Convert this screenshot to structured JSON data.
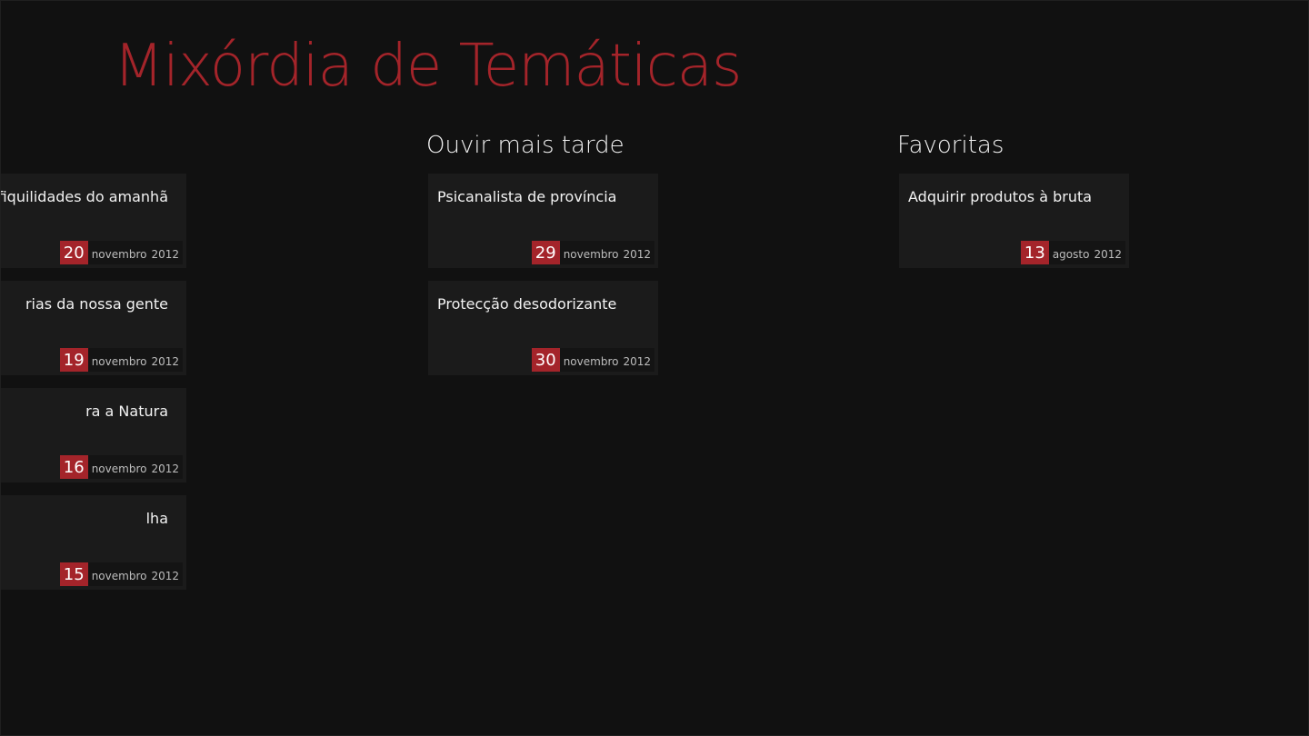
{
  "app": {
    "title": "Mixórdia de Temáticas",
    "accent_color": "#a4242a"
  },
  "groups": {
    "recent": {
      "header": "",
      "items": [
        {
          "title": "difiquilidades do amanhã",
          "day": "20",
          "month": "novembro",
          "year": "2012"
        },
        {
          "title": "rias da nossa gente",
          "day": "19",
          "month": "novembro",
          "year": "2012"
        },
        {
          "title": "ra a Natura",
          "day": "16",
          "month": "novembro",
          "year": "2012"
        },
        {
          "title": "lha",
          "day": "15",
          "month": "novembro",
          "year": "2012"
        }
      ]
    },
    "listen_later": {
      "header": "Ouvir mais tarde",
      "items": [
        {
          "title": "Psicanalista de província",
          "day": "29",
          "month": "novembro",
          "year": "2012"
        },
        {
          "title": "Protecção desodorizante",
          "day": "30",
          "month": "novembro",
          "year": "2012"
        }
      ]
    },
    "favorites": {
      "header": "Favoritas",
      "items": [
        {
          "title": "Adquirir produtos à bruta",
          "day": "13",
          "month": "agosto",
          "year": "2012"
        }
      ]
    }
  }
}
